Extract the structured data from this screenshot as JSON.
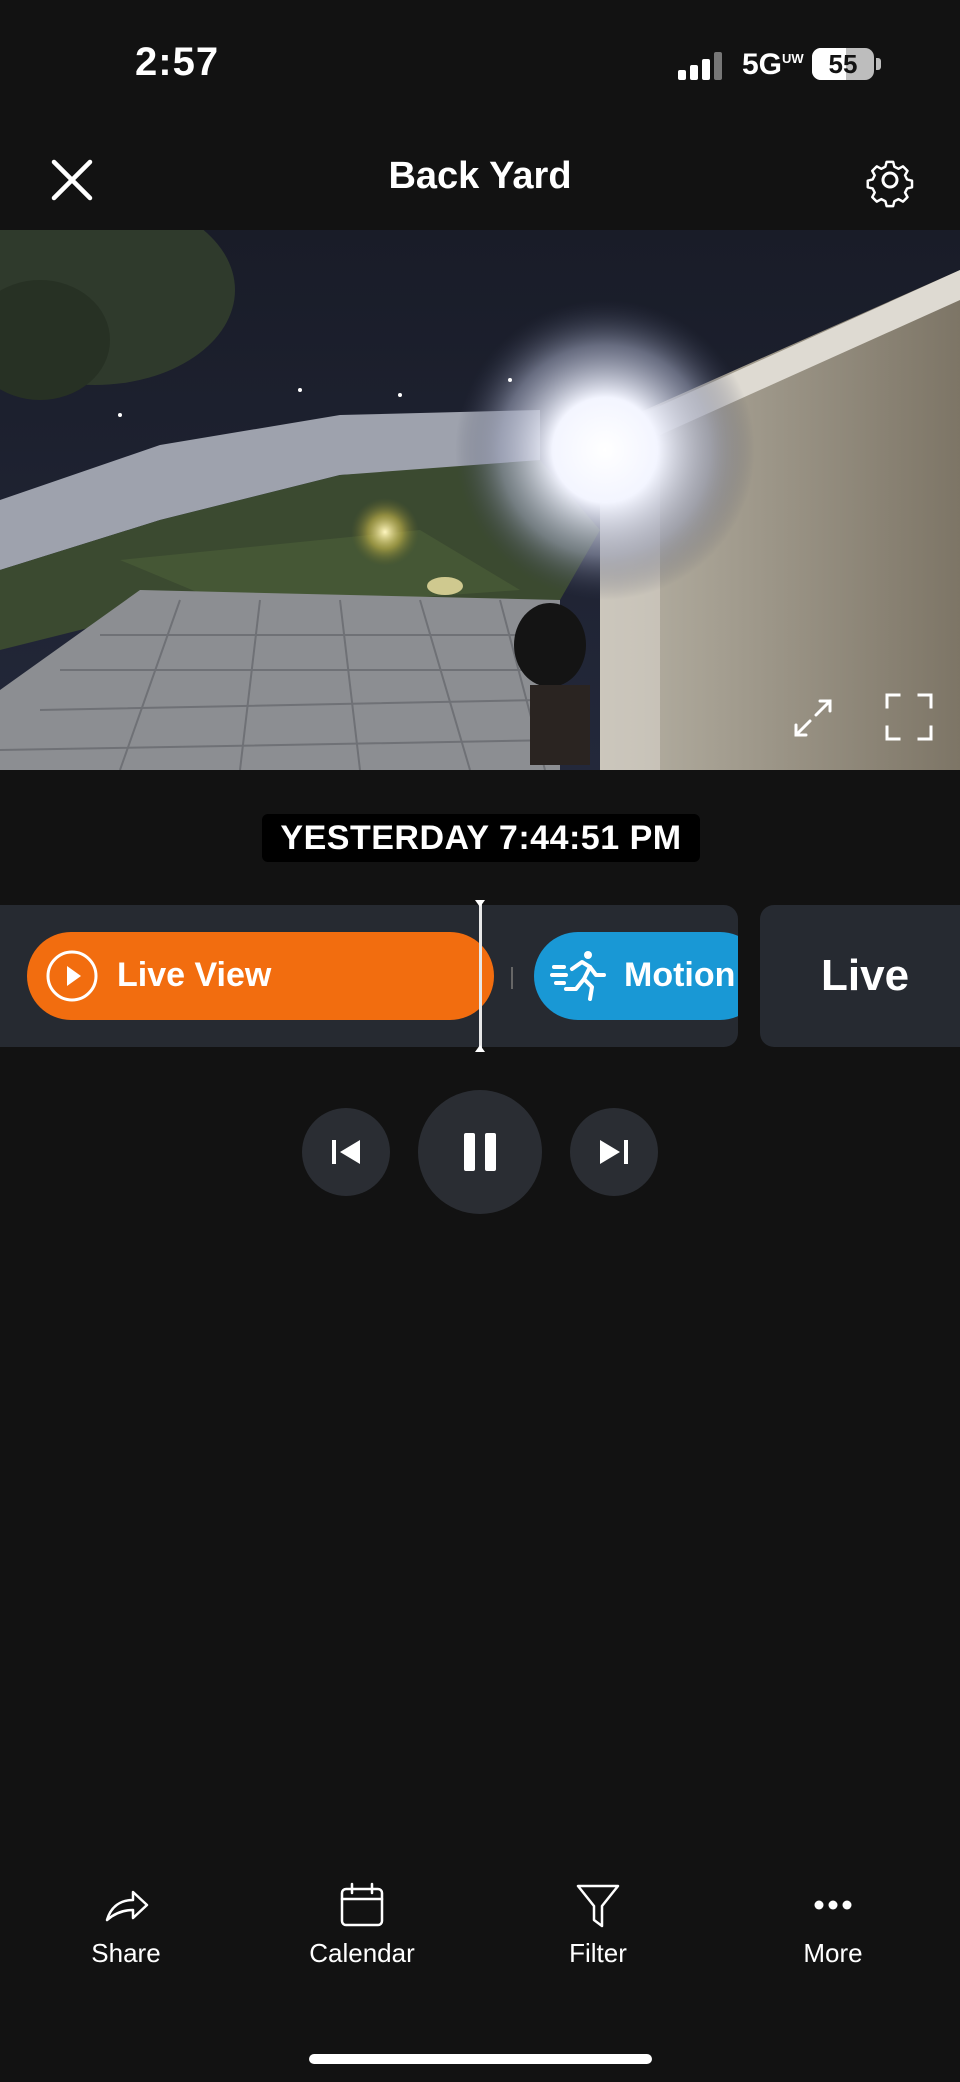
{
  "status_bar": {
    "time": "2:57",
    "network": "5G",
    "network_sup": "UW",
    "battery": "55",
    "battery_level": 0.55
  },
  "header": {
    "title": "Back Yard"
  },
  "video": {
    "timestamp": "YESTERDAY 7:44:51 PM"
  },
  "timeline": {
    "live_view_label": "Live View",
    "motion_label": "Motion",
    "live_card_label": "Live",
    "colors": {
      "live_view": "#f26d0f",
      "motion": "#1998d5"
    }
  },
  "bottom_nav": {
    "share": "Share",
    "calendar": "Calendar",
    "filter": "Filter",
    "more": "More"
  }
}
